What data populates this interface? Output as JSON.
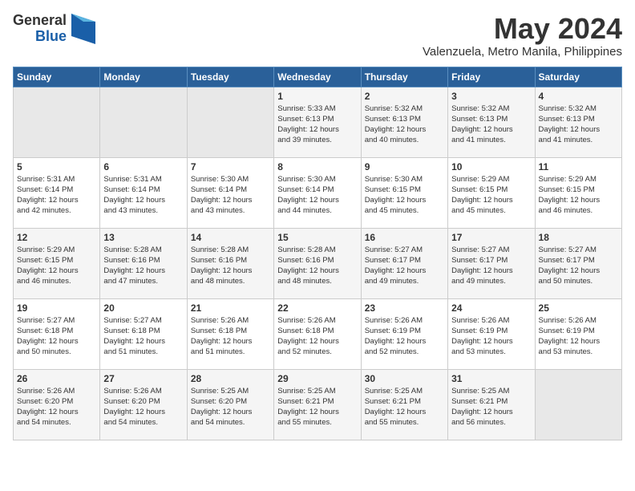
{
  "header": {
    "logo_general": "General",
    "logo_blue": "Blue",
    "month_year": "May 2024",
    "location": "Valenzuela, Metro Manila, Philippines"
  },
  "days_of_week": [
    "Sunday",
    "Monday",
    "Tuesday",
    "Wednesday",
    "Thursday",
    "Friday",
    "Saturday"
  ],
  "weeks": [
    [
      {
        "day": "",
        "info": ""
      },
      {
        "day": "",
        "info": ""
      },
      {
        "day": "",
        "info": ""
      },
      {
        "day": "1",
        "info": "Sunrise: 5:33 AM\nSunset: 6:13 PM\nDaylight: 12 hours\nand 39 minutes."
      },
      {
        "day": "2",
        "info": "Sunrise: 5:32 AM\nSunset: 6:13 PM\nDaylight: 12 hours\nand 40 minutes."
      },
      {
        "day": "3",
        "info": "Sunrise: 5:32 AM\nSunset: 6:13 PM\nDaylight: 12 hours\nand 41 minutes."
      },
      {
        "day": "4",
        "info": "Sunrise: 5:32 AM\nSunset: 6:13 PM\nDaylight: 12 hours\nand 41 minutes."
      }
    ],
    [
      {
        "day": "5",
        "info": "Sunrise: 5:31 AM\nSunset: 6:14 PM\nDaylight: 12 hours\nand 42 minutes."
      },
      {
        "day": "6",
        "info": "Sunrise: 5:31 AM\nSunset: 6:14 PM\nDaylight: 12 hours\nand 43 minutes."
      },
      {
        "day": "7",
        "info": "Sunrise: 5:30 AM\nSunset: 6:14 PM\nDaylight: 12 hours\nand 43 minutes."
      },
      {
        "day": "8",
        "info": "Sunrise: 5:30 AM\nSunset: 6:14 PM\nDaylight: 12 hours\nand 44 minutes."
      },
      {
        "day": "9",
        "info": "Sunrise: 5:30 AM\nSunset: 6:15 PM\nDaylight: 12 hours\nand 45 minutes."
      },
      {
        "day": "10",
        "info": "Sunrise: 5:29 AM\nSunset: 6:15 PM\nDaylight: 12 hours\nand 45 minutes."
      },
      {
        "day": "11",
        "info": "Sunrise: 5:29 AM\nSunset: 6:15 PM\nDaylight: 12 hours\nand 46 minutes."
      }
    ],
    [
      {
        "day": "12",
        "info": "Sunrise: 5:29 AM\nSunset: 6:15 PM\nDaylight: 12 hours\nand 46 minutes."
      },
      {
        "day": "13",
        "info": "Sunrise: 5:28 AM\nSunset: 6:16 PM\nDaylight: 12 hours\nand 47 minutes."
      },
      {
        "day": "14",
        "info": "Sunrise: 5:28 AM\nSunset: 6:16 PM\nDaylight: 12 hours\nand 48 minutes."
      },
      {
        "day": "15",
        "info": "Sunrise: 5:28 AM\nSunset: 6:16 PM\nDaylight: 12 hours\nand 48 minutes."
      },
      {
        "day": "16",
        "info": "Sunrise: 5:27 AM\nSunset: 6:17 PM\nDaylight: 12 hours\nand 49 minutes."
      },
      {
        "day": "17",
        "info": "Sunrise: 5:27 AM\nSunset: 6:17 PM\nDaylight: 12 hours\nand 49 minutes."
      },
      {
        "day": "18",
        "info": "Sunrise: 5:27 AM\nSunset: 6:17 PM\nDaylight: 12 hours\nand 50 minutes."
      }
    ],
    [
      {
        "day": "19",
        "info": "Sunrise: 5:27 AM\nSunset: 6:18 PM\nDaylight: 12 hours\nand 50 minutes."
      },
      {
        "day": "20",
        "info": "Sunrise: 5:27 AM\nSunset: 6:18 PM\nDaylight: 12 hours\nand 51 minutes."
      },
      {
        "day": "21",
        "info": "Sunrise: 5:26 AM\nSunset: 6:18 PM\nDaylight: 12 hours\nand 51 minutes."
      },
      {
        "day": "22",
        "info": "Sunrise: 5:26 AM\nSunset: 6:18 PM\nDaylight: 12 hours\nand 52 minutes."
      },
      {
        "day": "23",
        "info": "Sunrise: 5:26 AM\nSunset: 6:19 PM\nDaylight: 12 hours\nand 52 minutes."
      },
      {
        "day": "24",
        "info": "Sunrise: 5:26 AM\nSunset: 6:19 PM\nDaylight: 12 hours\nand 53 minutes."
      },
      {
        "day": "25",
        "info": "Sunrise: 5:26 AM\nSunset: 6:19 PM\nDaylight: 12 hours\nand 53 minutes."
      }
    ],
    [
      {
        "day": "26",
        "info": "Sunrise: 5:26 AM\nSunset: 6:20 PM\nDaylight: 12 hours\nand 54 minutes."
      },
      {
        "day": "27",
        "info": "Sunrise: 5:26 AM\nSunset: 6:20 PM\nDaylight: 12 hours\nand 54 minutes."
      },
      {
        "day": "28",
        "info": "Sunrise: 5:25 AM\nSunset: 6:20 PM\nDaylight: 12 hours\nand 54 minutes."
      },
      {
        "day": "29",
        "info": "Sunrise: 5:25 AM\nSunset: 6:21 PM\nDaylight: 12 hours\nand 55 minutes."
      },
      {
        "day": "30",
        "info": "Sunrise: 5:25 AM\nSunset: 6:21 PM\nDaylight: 12 hours\nand 55 minutes."
      },
      {
        "day": "31",
        "info": "Sunrise: 5:25 AM\nSunset: 6:21 PM\nDaylight: 12 hours\nand 56 minutes."
      },
      {
        "day": "",
        "info": ""
      }
    ]
  ]
}
